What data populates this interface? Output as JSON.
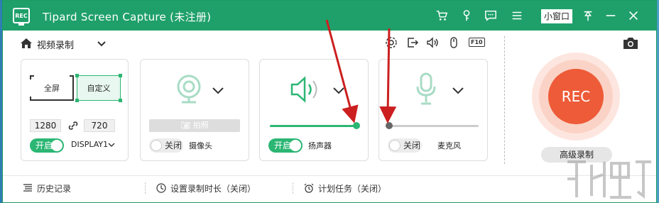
{
  "titlebar": {
    "logo": "REC",
    "title": "Tipard Screen Capture (未注册)",
    "mini_window": "小窗口",
    "icons": [
      "cart-icon",
      "key-icon",
      "chat-icon",
      "menu-icon",
      "pin-icon",
      "minimize-icon",
      "close-icon"
    ]
  },
  "topbar": {
    "mode": "视频录制",
    "tools": [
      "settings-icon",
      "export-icon",
      "speaker-icon",
      "mouse-icon",
      "f10-icon"
    ],
    "f10": "F10"
  },
  "screen": {
    "full": "全屏",
    "custom": "自定义",
    "width": "1280",
    "height": "720",
    "toggle": "开启",
    "display": "DISPLAY1"
  },
  "camera": {
    "photo": "拍照",
    "toggle": "关闭",
    "label": "摄像头"
  },
  "speaker": {
    "toggle": "开启",
    "label": "扬声器",
    "volume": 1.0
  },
  "mic": {
    "toggle": "关闭",
    "label": "麦克风",
    "volume": 0.0
  },
  "rec": {
    "label": "REC",
    "advanced": "高级录制"
  },
  "footer": {
    "history": "历史记录",
    "duration": "设置录制时长（关闭）",
    "schedule": "计划任务（关闭）"
  },
  "colors": {
    "titlebar": "#1fa06a",
    "accent": "#2bb673",
    "rec": "#ee5b38"
  }
}
